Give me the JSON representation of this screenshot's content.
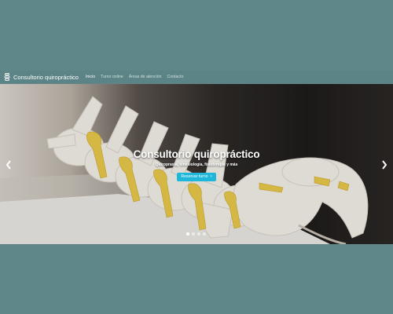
{
  "navbar": {
    "brand": "Consultorio quiropráctico",
    "links": [
      {
        "label": "Inicio",
        "active": true
      },
      {
        "label": "Turno online",
        "active": false
      },
      {
        "label": "Áreas de atención",
        "active": false
      },
      {
        "label": "Contacto",
        "active": false
      }
    ]
  },
  "hero": {
    "title": "Consultorio quiropráctico",
    "subtitle": "Quiropraxia, kinesiología, fisioterapia y más",
    "cta_label": "Reservar turno",
    "slide_count": 4,
    "active_slide": 1
  },
  "icons": {
    "brand": "spine-icon",
    "prev": "chevron-left-icon",
    "next": "chevron-right-icon",
    "cta": "chevron-right-icon"
  },
  "colors": {
    "page_background": "#5f8688",
    "cta_background": "#1fb7d9",
    "nav_text": "#cfe0e0"
  }
}
